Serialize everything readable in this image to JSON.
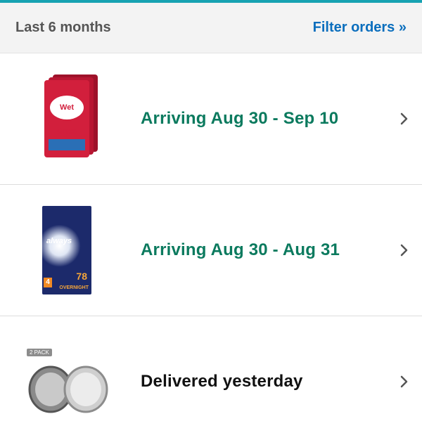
{
  "filter_bar": {
    "period_label": "Last 6 months",
    "filter_link": "Filter orders »"
  },
  "orders": [
    {
      "status": "Arriving Aug 30 - Sep 10",
      "status_color": "#0b7a5e",
      "image_label": "Wet Ones"
    },
    {
      "status": "Arriving Aug 30 - Aug 31",
      "status_color": "#0b7a5e",
      "image_label": "always",
      "image_count": "78",
      "image_sub": "OVERNIGHT",
      "image_size": "4"
    },
    {
      "status": "Delivered yesterday",
      "status_color": "#111111",
      "image_tag": "2 PACK"
    }
  ],
  "colors": {
    "accent_topline": "#17a2b2",
    "link": "#0a6ebd"
  }
}
